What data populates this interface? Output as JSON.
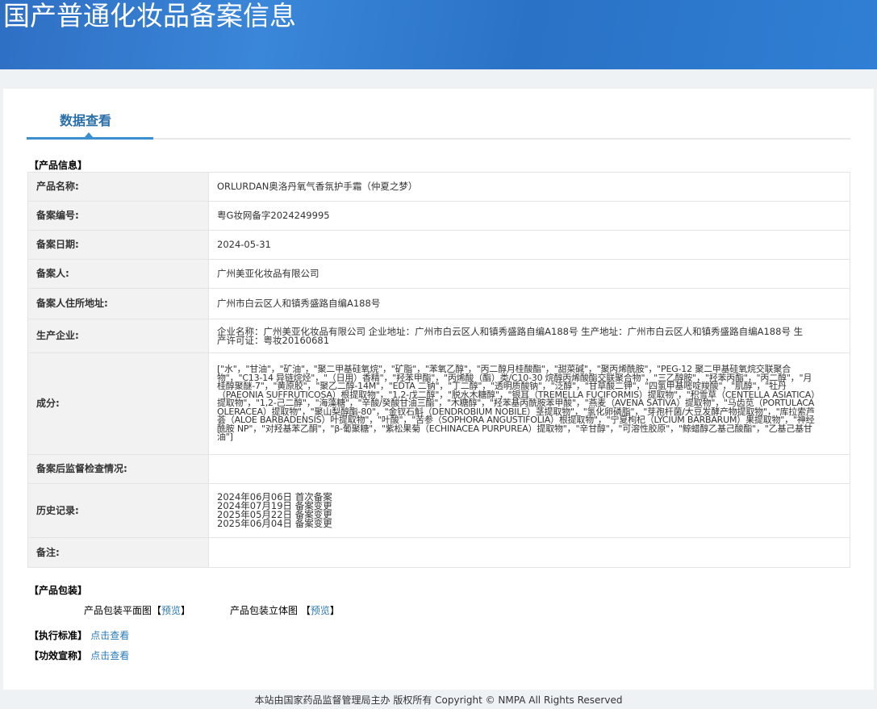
{
  "header": {
    "title": "国产普通化妆品备案信息"
  },
  "tab": {
    "label": "数据查看"
  },
  "sections": {
    "product_info": "【产品信息】",
    "packaging": "【产品包装】",
    "standard": "【执行标准】",
    "efficacy": "【功效宣称】"
  },
  "rows": [
    {
      "label": "产品名称:",
      "value": "ORLURDAN奥洛丹氧气香氛护手霜（仲夏之梦）"
    },
    {
      "label": "备案编号:",
      "value": "粤G妆网备字2024249995"
    },
    {
      "label": "备案日期:",
      "value": "2024-05-31"
    },
    {
      "label": "备案人:",
      "value": "广州美亚化妆品有限公司"
    },
    {
      "label": "备案人住所地址:",
      "value": "广州市白云区人和镇秀盛路自编A188号"
    },
    {
      "label": "生产企业:",
      "value": "企业名称：广州美亚化妆品有限公司 企业地址：广州市白云区人和镇秀盛路自编A188号 生产地址：广州市白云区人和镇秀盛路自编A188号 生产许可证：粤妆20160681"
    },
    {
      "label": "成分:",
      "value": "[\"水\"，\"甘油\"，\"矿油\"，\"聚二甲基硅氧烷\"，\"矿脂\"，\"苯氧乙醇\"，\"丙二醇月桂酸酯\"，\"甜菜碱\"，\"聚丙烯酰胺\"，\"PEG-12 聚二甲基硅氧烷交联聚合物\"，\"C13-14 异链烷烃\"，\"（日用）香精\"，\"羟苯甲酯\"，\"丙烯酸（酯）类/C10-30 烷醇丙烯酸酯交联聚合物\"，\"三乙醇胺\"，\"羟苯丙酯\"，\"丙二醇\"，\"月桂醇聚醚-7\"，\"黄原胶\"，\"聚乙二醇-14M\"，\"EDTA 二钠\"，\"丁二醇\"，\"透明质酸钠\"，\"泛醇\"，\"甘草酸二钾\"，\"四氢甲基嘧啶羧酸\"，\"肌醇\"，\"牡丹（PAEONIA SUFFRUTICOSA）根提取物\"，\"1,2-戊二醇\"，\"脱水木糖醇\"，\"银耳（TREMELLA FUCIFORMIS）提取物\"，\"积雪草（CENTELLA ASIATICA）提取物\"，\"1,2-己二醇\"，\"海藻糖\"，\"辛酸/癸酸甘油三酯\"，\"木糖醇\"，\"羟苯基丙酰胺苯甲酸\"，\"燕麦（AVENA SATIVA）提取物\"，\"马齿苋（PORTULACA OLERACEA）提取物\"，\"聚山梨醇酯-80\"，\"金钗石斛（DENDROBIUM NOBILE）茎提取物\"，\"氢化卵磷脂\"，\"芽孢杆菌/大豆发酵产物提取物\"，\"库拉索芦荟（ALOE BARBADENSIS）叶提取物\"，\"叶酸\"，\"苦参（SOPHORA ANGUSTIFOLIA）根提取物\"，\"宁夏枸杞（LYCIUM BARBARUM）果提取物\"，\"神经酰胺 NP\"，\"对羟基苯乙酮\"，\"β-葡聚糖\"，\"紫松果菊（ECHINACEA PURPUREA）提取物\"，\"辛甘醇\"，\"可溶性胶原\"，\"鲸蜡醇乙基己酸酯\"，\"乙基己基甘油\"]"
    },
    {
      "label": "备案后监督检查情况:",
      "value": ""
    },
    {
      "label": "历史记录:",
      "value": ""
    },
    {
      "label": "备注:",
      "value": ""
    }
  ],
  "history": [
    "2024年06月06日 首次备案",
    "2024年07月19日 备案变更",
    "2025年05月22日 备案变更",
    "2025年06月04日 备案变更"
  ],
  "packaging": {
    "flat_label": "产品包装平面图",
    "solid_label": "产品包装立体图",
    "open_bracket": "【",
    "close_bracket": "】",
    "preview": "预览"
  },
  "links": {
    "view": "点击查看"
  },
  "footer": "本站由国家药品监督管理局主办 版权所有 Copyright © NMPA All Rights Reserved"
}
